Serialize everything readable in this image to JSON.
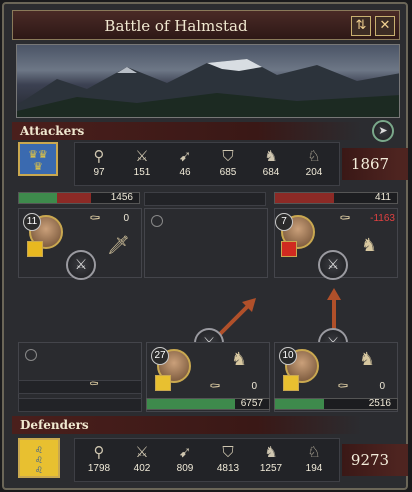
{
  "window": {
    "title": "Battle of Halmstad"
  },
  "attackers": {
    "label": "Attackers",
    "total": "1867",
    "stats": [
      {
        "icon": "light-infantry-icon",
        "glyph": "⚲",
        "value": "97"
      },
      {
        "icon": "heavy-infantry-icon",
        "glyph": "⚔",
        "value": "151"
      },
      {
        "icon": "archers-icon",
        "glyph": "➹",
        "value": "46"
      },
      {
        "icon": "pikemen-icon",
        "glyph": "⛉",
        "value": "685"
      },
      {
        "icon": "light-cavalry-icon",
        "glyph": "♞",
        "value": "684"
      },
      {
        "icon": "knights-icon",
        "glyph": "♘",
        "value": "204"
      }
    ],
    "left": {
      "bar": "1456",
      "commander_level": "11",
      "sub": "0",
      "fill": 0.32
    },
    "right": {
      "bar": "411",
      "commander_level": "7",
      "loss": "-1163",
      "fill": 0.05
    }
  },
  "defenders": {
    "label": "Defenders",
    "total": "9273",
    "stats": [
      {
        "icon": "light-infantry-icon",
        "glyph": "⚲",
        "value": "1798"
      },
      {
        "icon": "heavy-infantry-icon",
        "glyph": "⚔",
        "value": "402"
      },
      {
        "icon": "archers-icon",
        "glyph": "➹",
        "value": "809"
      },
      {
        "icon": "pikemen-icon",
        "glyph": "⛉",
        "value": "4813"
      },
      {
        "icon": "light-cavalry-icon",
        "glyph": "♞",
        "value": "1257"
      },
      {
        "icon": "knights-icon",
        "glyph": "♘",
        "value": "194"
      }
    ],
    "center": {
      "bar": "6757",
      "commander_level": "27",
      "sub": "0",
      "fill": 0.72
    },
    "right": {
      "bar": "2516",
      "commander_level": "10",
      "sub": "0",
      "fill": 0.4
    }
  },
  "colors": {
    "attacker_bar": "#8c2a26",
    "defender_bar": "#3e8a4c",
    "loss": "#e04040"
  }
}
